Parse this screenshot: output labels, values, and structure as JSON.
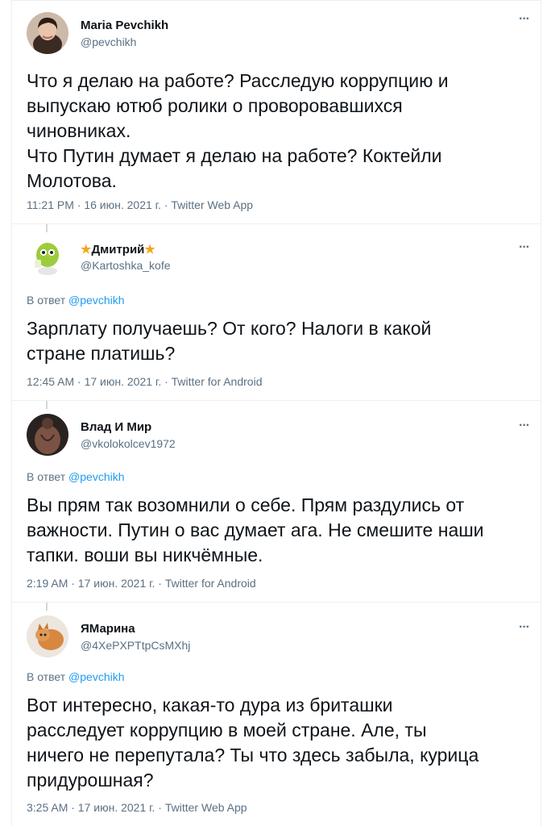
{
  "tweets": [
    {
      "name": "Maria Pevchikh",
      "handle": "@pevchikh",
      "text": "Что я делаю на работе? Расследую коррупцию и\nвыпускаю ютюб ролики о проворовавшихся\nчиновниках.\nЧто Путин думает я делаю на работе? Коктейли\nМолотова.",
      "meta": "11:21 PM · 16 июн. 2021 г. · Twitter Web App",
      "more": "···"
    },
    {
      "name": "Дмитрий",
      "name_prefix": "★",
      "name_suffix": "★",
      "handle": "@Kartoshka_kofe",
      "reply_prefix": "В ответ",
      "reply_to": "@pevchikh",
      "text": "Зарплату получаешь? От кого? Налоги в какой\nстране платишь?",
      "meta": "12:45 AM · 17 июн. 2021 г. · Twitter for Android",
      "more": "···"
    },
    {
      "name": "Влад И Мир",
      "handle": "@vkolokolcev1972",
      "reply_prefix": "В ответ",
      "reply_to": "@pevchikh",
      "text": "Вы прям так возомнили о себе. Прям раздулись от\nважности. Путин о вас думает ага. Не смешите наши\nтапки. воши вы никчёмные.",
      "meta": "2:19 AM · 17 июн. 2021 г. · Twitter for Android",
      "more": "···"
    },
    {
      "name": "ЯМарина",
      "handle": "@4XePXPTtpCsMXhj",
      "reply_prefix": "В ответ",
      "reply_to": "@pevchikh",
      "text": "Вот интересно, какая-то дура из бриташки\nрасследует коррупцию в моей стране. Але, ты\nничего не перепутала? Ты что здесь забыла, курица\nпридурошная?",
      "meta": "3:25 AM · 17 июн. 2021 г. · Twitter Web App",
      "more": "···"
    }
  ]
}
